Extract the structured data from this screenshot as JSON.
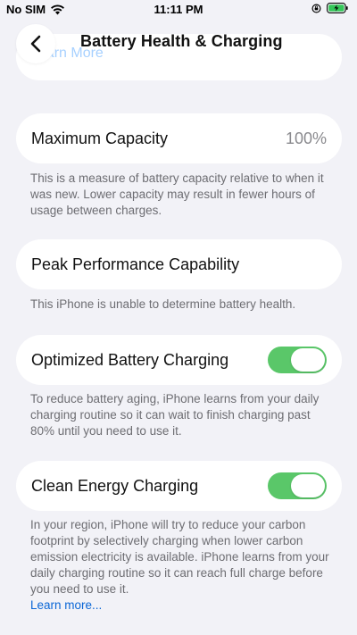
{
  "status_bar": {
    "carrier": "No SIM",
    "time": "11:11 PM",
    "icons": [
      "wifi-icon",
      "orientation-lock-icon",
      "battery-charging-icon"
    ]
  },
  "nav": {
    "back_icon": "chevron-left-icon",
    "title": "Battery Health & Charging"
  },
  "ghost": {
    "link": "Learn More"
  },
  "maximum_capacity": {
    "label": "Maximum Capacity",
    "value": "100%",
    "footnote": "This is a measure of battery capacity relative to when it was new. Lower capacity may result in fewer hours of usage between charges."
  },
  "peak_performance": {
    "label": "Peak Performance Capability",
    "footnote": "This iPhone is unable to determine battery health."
  },
  "optimized_charging": {
    "label": "Optimized Battery Charging",
    "enabled": true,
    "footnote": "To reduce battery aging, iPhone learns from your daily charging routine so it can wait to finish charging past 80% until you need to use it."
  },
  "clean_energy": {
    "label": "Clean Energy Charging",
    "enabled": true,
    "footnote": "In your region, iPhone will try to reduce your carbon footprint by selectively charging when lower carbon emission electricity is available. iPhone learns from your daily charging routine so it can reach full charge before you need to use it.",
    "link": "Learn more..."
  },
  "colors": {
    "background": "#f2f2f7",
    "toggle_on": "#5ac769",
    "link": "#0a66d6",
    "battery_charging": "#34c759"
  }
}
